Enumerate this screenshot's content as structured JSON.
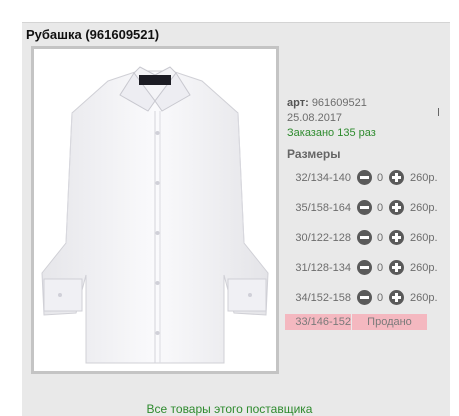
{
  "product": {
    "title": "Рубашка (961609521)",
    "art_label": "арт:",
    "art_value": "961609521",
    "date": "25.08.2017",
    "ordered": "Заказано 135 раз"
  },
  "sizes": {
    "title": "Размеры",
    "rows": [
      {
        "size": "32/134-140",
        "qty": "0",
        "price": "260р."
      },
      {
        "size": "35/158-164",
        "qty": "0",
        "price": "260р."
      },
      {
        "size": "30/122-128",
        "qty": "0",
        "price": "260р."
      },
      {
        "size": "31/128-134",
        "qty": "0",
        "price": "260р."
      },
      {
        "size": "34/152-158",
        "qty": "0",
        "price": "260р."
      }
    ],
    "sold": {
      "size": "33/146-152",
      "status": "Продано"
    }
  },
  "footer": {
    "supplier_link": "Все товары этого поставщика"
  },
  "colors": {
    "ordered_green": "#2e8b2e",
    "sold_pink": "#f4b8c0",
    "button_gray": "#5a5a5a"
  },
  "icons": [
    "minus-icon",
    "plus-icon"
  ]
}
